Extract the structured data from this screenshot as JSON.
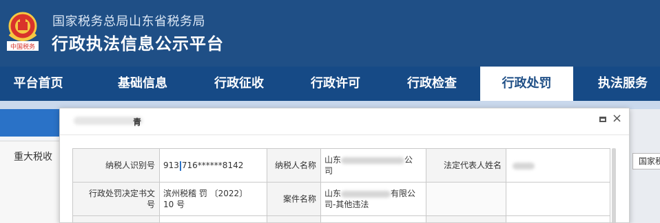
{
  "header": {
    "org_name": "国家税务总局山东省税务局",
    "site_title": "行政执法信息公示平台",
    "emblem_text": "中国税务"
  },
  "nav": {
    "items": [
      {
        "label": "平台首页"
      },
      {
        "label": "基础信息"
      },
      {
        "label": "行政征收"
      },
      {
        "label": "行政许可"
      },
      {
        "label": "行政检查"
      },
      {
        "label": "行政处罚"
      },
      {
        "label": "执法服务"
      }
    ],
    "active_index": 5
  },
  "background": {
    "left_label": "重大税收",
    "right_button": "国家税"
  },
  "modal": {
    "title_fragment": "青",
    "maximize_icon": "maximize-icon",
    "close_icon": "×",
    "table": {
      "row1": {
        "taxpayer_id_label": "纳税人识别号",
        "taxpayer_id_pre": "913",
        "taxpayer_id_post": "716******8142",
        "taxpayer_name_label": "纳税人名称",
        "taxpayer_name_pre": "山东",
        "taxpayer_name_suffix": "公",
        "taxpayer_name_line2": "司",
        "legal_rep_label": "法定代表人姓名"
      },
      "row2": {
        "decision_label_line1": "行政处罚决定书文",
        "decision_label_line2": "号",
        "decision_value_line1": "滨州税稽 罚 〔2022〕",
        "decision_value_line2": "10 号",
        "case_name_label": "案件名称",
        "case_name_pre": "山东",
        "case_name_suffix": "有限公",
        "case_name_line2": "司-其他违法"
      }
    }
  },
  "colors": {
    "header_bg": "#1f4f86",
    "nav_bg": "#164a86",
    "active_nav_text": "#1f4f86",
    "accent_blue": "#2a72c7"
  }
}
